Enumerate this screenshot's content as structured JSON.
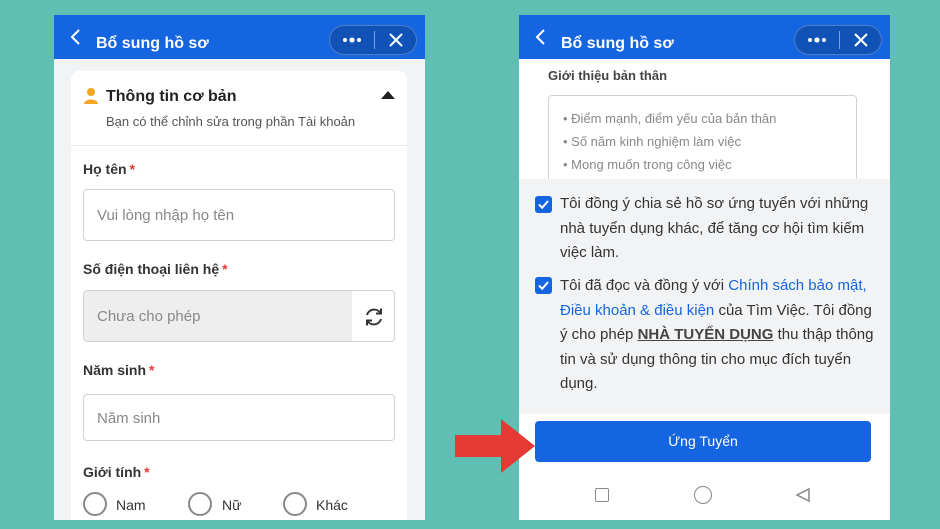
{
  "left_screen": {
    "title": "Bổ sung hồ sơ",
    "section": {
      "title": "Thông tin cơ bản",
      "subtitle": "Bạn có thể chỉnh sửa trong phần Tài khoản"
    },
    "fields": {
      "name": {
        "label": "Họ tên",
        "required": "*",
        "placeholder": "Vui lòng nhập họ tên"
      },
      "phone": {
        "label": "Số điện thoại liên hệ",
        "required": "*",
        "placeholder": "Chưa cho phép"
      },
      "birth_year": {
        "label": "Năm sinh",
        "required": "*",
        "placeholder": "Năm sinh"
      },
      "gender": {
        "label": "Giới tính",
        "required": "*",
        "options": [
          "Nam",
          "Nữ",
          "Khác"
        ]
      }
    }
  },
  "right_screen": {
    "title": "Bổ sung hồ sơ",
    "intro": {
      "label": "Giới thiệu bản thân",
      "hints": [
        "• Điểm mạnh, điểm yếu của bản thân",
        "• Số năm kinh nghiệm làm việc",
        "• Mong muốn trong công việc"
      ]
    },
    "consent_share": "Tôi đồng ý chia sẻ hồ sơ ứng tuyển với những nhà tuyển dụng khác, để tăng cơ hội tìm kiếm việc làm.",
    "consent_policy": {
      "prefix": "Tôi đã đọc và đồng ý với ",
      "link": "Chính sách bảo mật, Điều khoản & điều kiện",
      "middle": " của Tìm Việc. Tôi đồng ý cho phép ",
      "emphasis": "NHÀ TUYỂN DỤNG",
      "suffix": " thu thập thông tin và sử dụng thông tin cho mục đích tuyển dụng."
    },
    "apply_button": "Ứng Tuyển"
  },
  "colors": {
    "background": "#5fbfb3",
    "primary": "#1565e0",
    "required": "#e53935",
    "arrow": "#e53935"
  },
  "icons": [
    "back-icon",
    "more-dots-icon",
    "close-icon",
    "person-icon",
    "caret-up-icon",
    "refresh-icon",
    "checkbox-checked-icon",
    "nav-recent-icon",
    "nav-home-icon",
    "nav-back-icon",
    "pointer-arrow"
  ]
}
